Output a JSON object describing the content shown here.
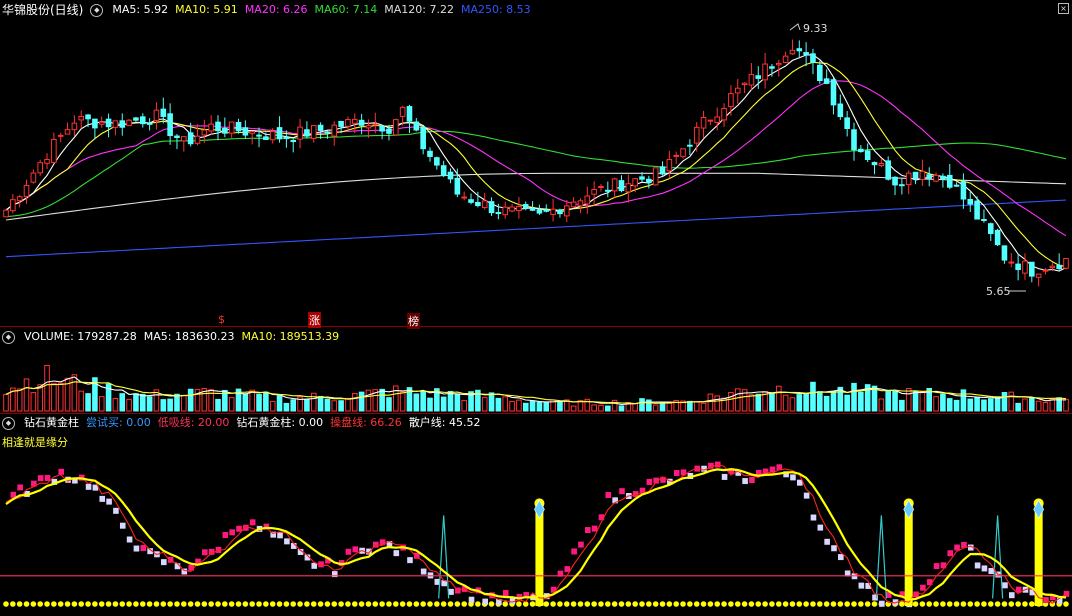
{
  "stock_title": "华锦股份(日线)",
  "ma_legend": [
    {
      "label": "MA5: 5.92",
      "color": "#ffffff"
    },
    {
      "label": "MA10: 5.91",
      "color": "#ffff33"
    },
    {
      "label": "MA20: 6.26",
      "color": "#ff33ff"
    },
    {
      "label": "MA60: 7.14",
      "color": "#33dd33"
    },
    {
      "label": "MA120: 7.22",
      "color": "#dddddd"
    },
    {
      "label": "MA250: 8.53",
      "color": "#3355ff"
    }
  ],
  "price_labels": {
    "high": "9.33",
    "low": "5.65"
  },
  "tags": [
    "$",
    "涨",
    "榜"
  ],
  "volume_legend": {
    "title": "VOLUME: 179287.28",
    "ma5": "MA5: 183630.23",
    "ma10": "MA10: 189513.39"
  },
  "indicator_legend": {
    "title": "钻石黄金柱",
    "items": [
      {
        "label": "尝试买: 0.00",
        "color": "#3399ff"
      },
      {
        "label": "低吸线: 20.00",
        "color": "#ff3355"
      },
      {
        "label": "钻石黄金柱: 0.00",
        "color": "#ffffff"
      },
      {
        "label": "操盘线: 66.26",
        "color": "#ff3333"
      },
      {
        "label": "散户线: 45.52",
        "color": "#ffffff"
      }
    ]
  },
  "indicator_caption": "相逢就是缘分",
  "colors": {
    "up": "#ff3232",
    "down": "#54ffff",
    "ma5": "#ffffff",
    "ma10": "#ffff33",
    "ma20": "#ff33ff",
    "ma60": "#33dd33",
    "ma120": "#dddddd",
    "ma250": "#3355ff",
    "ind_up": "#ff1a80",
    "ind_down": "#d7d7ff",
    "gold": "#ffff00",
    "cyan_spike": "#33cccc",
    "lowline": "#ff3366"
  },
  "chart_data": {
    "type": "candlestick",
    "bars": 156,
    "price_range": [
      5.35,
      9.55
    ],
    "close_anchors": [
      [
        0,
        6.7
      ],
      [
        6,
        7.55
      ],
      [
        10,
        8.05
      ],
      [
        16,
        8.0
      ],
      [
        22,
        8.1
      ],
      [
        26,
        7.7
      ],
      [
        30,
        7.95
      ],
      [
        34,
        7.9
      ],
      [
        40,
        7.8
      ],
      [
        46,
        7.9
      ],
      [
        52,
        8.05
      ],
      [
        56,
        7.95
      ],
      [
        58,
        8.2
      ],
      [
        60,
        7.8
      ],
      [
        66,
        6.95
      ],
      [
        72,
        6.7
      ],
      [
        78,
        6.6
      ],
      [
        84,
        6.9
      ],
      [
        90,
        7.1
      ],
      [
        96,
        7.25
      ],
      [
        102,
        8.0
      ],
      [
        106,
        8.4
      ],
      [
        112,
        8.9
      ],
      [
        115,
        9.2
      ],
      [
        120,
        8.6
      ],
      [
        124,
        7.7
      ],
      [
        130,
        7.15
      ],
      [
        134,
        7.3
      ],
      [
        138,
        7.15
      ],
      [
        142,
        6.6
      ],
      [
        146,
        6.0
      ],
      [
        150,
        5.8
      ],
      [
        153,
        5.9
      ],
      [
        155,
        5.95
      ]
    ],
    "ma_lines": [
      "MA5",
      "MA10",
      "MA20",
      "MA60",
      "MA120",
      "MA250"
    ],
    "ma250_range": [
      6.0,
      6.85
    ],
    "volume_range": [
      0,
      560000
    ],
    "volume_anchors": [
      [
        0,
        200000
      ],
      [
        5,
        300000
      ],
      [
        10,
        240000
      ],
      [
        20,
        130000
      ],
      [
        30,
        160000
      ],
      [
        40,
        110000
      ],
      [
        46,
        120000
      ],
      [
        52,
        140000
      ],
      [
        56,
        170000
      ],
      [
        60,
        160000
      ],
      [
        70,
        130000
      ],
      [
        80,
        70000
      ],
      [
        90,
        75000
      ],
      [
        100,
        85000
      ],
      [
        108,
        180000
      ],
      [
        114,
        200000
      ],
      [
        118,
        180000
      ],
      [
        124,
        170000
      ],
      [
        130,
        150000
      ],
      [
        140,
        140000
      ],
      [
        146,
        120000
      ],
      [
        155,
        100000
      ]
    ],
    "indicator": {
      "range": [
        0,
        100
      ],
      "anchors": [
        [
          0,
          70
        ],
        [
          4,
          80
        ],
        [
          8,
          88
        ],
        [
          12,
          82
        ],
        [
          16,
          60
        ],
        [
          20,
          35
        ],
        [
          26,
          25
        ],
        [
          30,
          35
        ],
        [
          34,
          55
        ],
        [
          38,
          50
        ],
        [
          44,
          30
        ],
        [
          48,
          25
        ],
        [
          52,
          40
        ],
        [
          56,
          40
        ],
        [
          60,
          30
        ],
        [
          64,
          15
        ],
        [
          68,
          8
        ],
        [
          72,
          5
        ],
        [
          76,
          4
        ],
        [
          80,
          10
        ],
        [
          84,
          40
        ],
        [
          88,
          70
        ],
        [
          92,
          78
        ],
        [
          96,
          82
        ],
        [
          100,
          88
        ],
        [
          104,
          90
        ],
        [
          108,
          85
        ],
        [
          112,
          90
        ],
        [
          116,
          85
        ],
        [
          120,
          40
        ],
        [
          124,
          20
        ],
        [
          128,
          5
        ],
        [
          132,
          4
        ],
        [
          136,
          25
        ],
        [
          140,
          40
        ],
        [
          144,
          20
        ],
        [
          148,
          8
        ],
        [
          152,
          6
        ],
        [
          155,
          5
        ]
      ],
      "low_line": 20,
      "gold_bars_at": [
        78,
        132,
        151
      ],
      "cyan_spikes_at": [
        64,
        128,
        145
      ]
    }
  }
}
